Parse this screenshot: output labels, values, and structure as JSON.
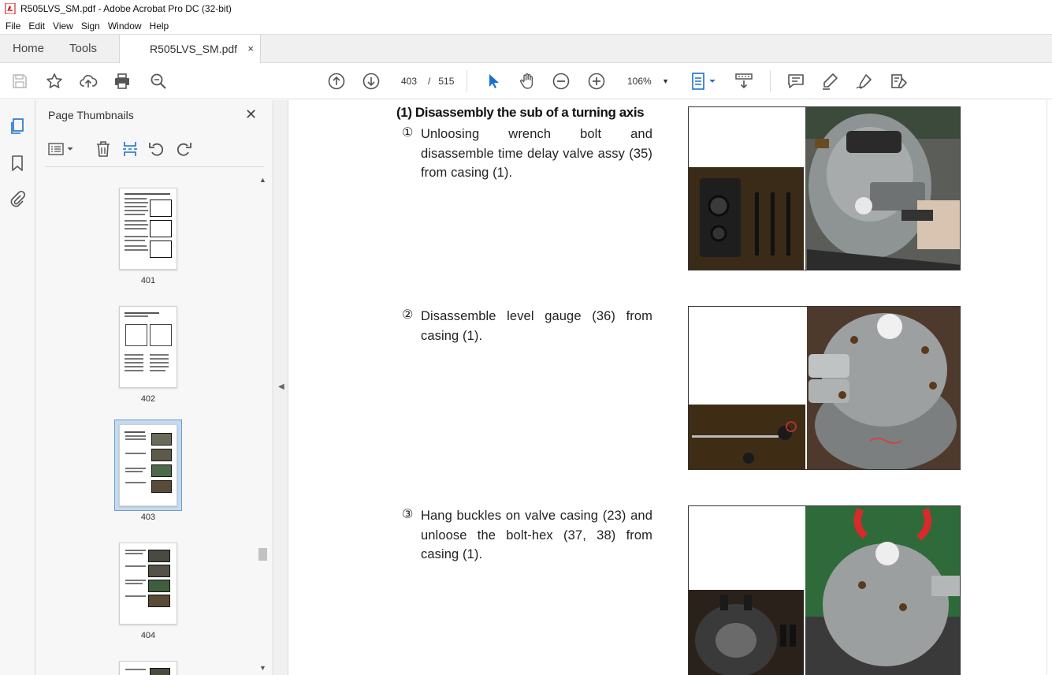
{
  "window": {
    "title": "R505LVS_SM.pdf - Adobe Acrobat Pro DC (32-bit)"
  },
  "menu": {
    "items": [
      "File",
      "Edit",
      "View",
      "Sign",
      "Window",
      "Help"
    ]
  },
  "tabs": {
    "home": "Home",
    "tools": "Tools",
    "document": "R505LVS_SM.pdf",
    "close_symbol": "×"
  },
  "toolbar": {
    "current_page": "403",
    "page_separator": "/",
    "total_pages": "515",
    "zoom": "106%",
    "icons": [
      "save-icon",
      "star-icon",
      "upload-icon",
      "print-icon",
      "zoom-search-icon",
      "page-up-icon",
      "page-down-icon",
      "select-arrow-icon",
      "hand-icon",
      "zoom-out-icon",
      "zoom-in-icon",
      "fit-page-icon",
      "scroll-mode-icon",
      "comment-icon",
      "highlight-icon",
      "sign-icon",
      "share-tool-icon"
    ]
  },
  "thumbnails_panel": {
    "title": "Page Thumbnails",
    "close_symbol": "✕",
    "pages": [
      {
        "number": "401",
        "selected": false
      },
      {
        "number": "402",
        "selected": false
      },
      {
        "number": "403",
        "selected": true
      },
      {
        "number": "404",
        "selected": false
      }
    ]
  },
  "document": {
    "heading": "(1) Disassembly the sub of a turning axis",
    "steps": [
      {
        "marker": "①",
        "text": "Unloosing wrench bolt and disassemble time delay valve assy (35) from casing (1)."
      },
      {
        "marker": "②",
        "text": "Disassemble level gauge (36) from casing (1)."
      },
      {
        "marker": "③",
        "text": "Hang buckles on valve casing (23) and unloose the bolt-hex (37, 38) from casing (1)."
      }
    ]
  },
  "colors": {
    "selection_fill": "#c5dbf0",
    "selection_border": "#6e9bd1",
    "accent_blue": "#1a6fd1",
    "toolbar_icon": "#555555"
  }
}
